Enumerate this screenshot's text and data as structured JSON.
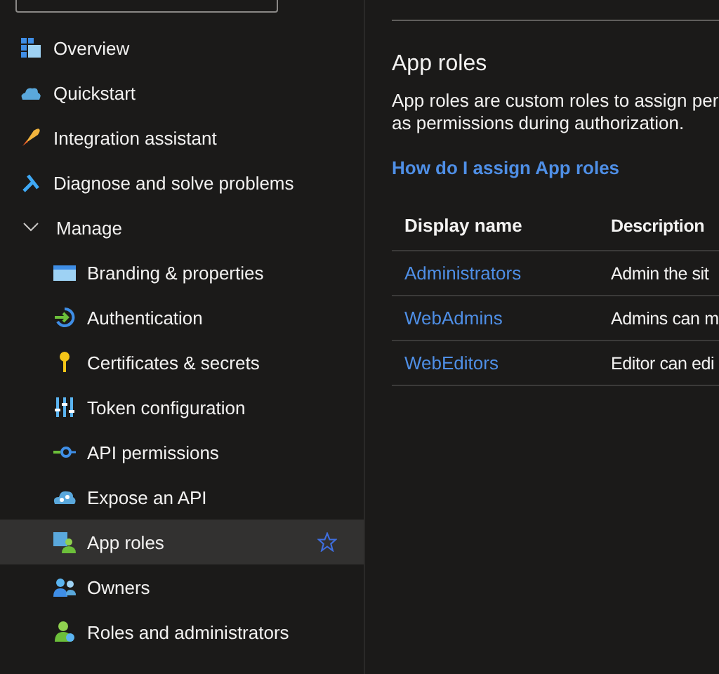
{
  "sidebar": {
    "items": [
      {
        "label": "Overview",
        "selected": false
      },
      {
        "label": "Quickstart",
        "selected": false
      },
      {
        "label": "Integration assistant",
        "selected": false
      },
      {
        "label": "Diagnose and solve problems",
        "selected": false
      }
    ],
    "group": {
      "label": "Manage",
      "expanded": true,
      "children": [
        {
          "label": "Branding & properties",
          "selected": false
        },
        {
          "label": "Authentication",
          "selected": false
        },
        {
          "label": "Certificates & secrets",
          "selected": false
        },
        {
          "label": "Token configuration",
          "selected": false
        },
        {
          "label": "API permissions",
          "selected": false
        },
        {
          "label": "Expose an API",
          "selected": false
        },
        {
          "label": "App roles",
          "selected": true
        },
        {
          "label": "Owners",
          "selected": false
        },
        {
          "label": "Roles and administrators",
          "selected": false
        }
      ]
    }
  },
  "main": {
    "title": "App roles",
    "description": [
      "App roles are custom roles to assign per",
      "as permissions during authorization."
    ],
    "help_link": "How do I assign App roles",
    "table": {
      "columns": [
        "Display name",
        "Description"
      ],
      "rows": [
        {
          "name": "Administrators",
          "description": "Admin the sit"
        },
        {
          "name": "WebAdmins",
          "description": "Admins can m"
        },
        {
          "name": "WebEditors",
          "description": "Editor can edi"
        }
      ]
    }
  }
}
